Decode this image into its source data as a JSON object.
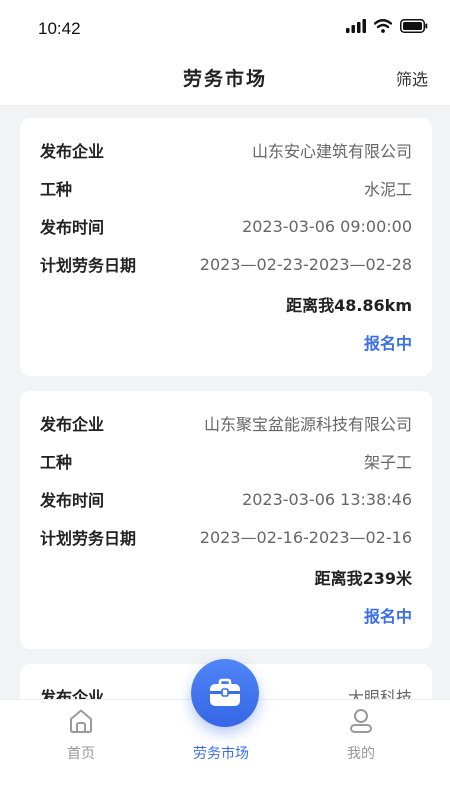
{
  "status_bar": {
    "time": "10:42"
  },
  "header": {
    "title": "劳务市场",
    "filter_label": "筛选"
  },
  "labels": {
    "company": "发布企业",
    "job_type": "工种",
    "publish_time": "发布时间",
    "plan_date": "计划劳务日期"
  },
  "jobs": [
    {
      "company": "山东安心建筑有限公司",
      "job_type": "水泥工",
      "publish_time": "2023-03-06 09:00:00",
      "plan_date": "2023—02-23-2023—02-28",
      "distance": "距离我48.86km",
      "status": "报名中"
    },
    {
      "company": "山东聚宝盆能源科技有限公司",
      "job_type": "架子工",
      "publish_time": "2023-03-06 13:38:46",
      "plan_date": "2023—02-16-2023—02-16",
      "distance": "距离我239米",
      "status": "报名中"
    },
    {
      "company": "大眼科技"
    }
  ],
  "tabbar": {
    "home": "首页",
    "market": "劳务市场",
    "mine": "我的"
  },
  "colors": {
    "accent": "#3a6fe8",
    "background": "#f2f3f5"
  }
}
